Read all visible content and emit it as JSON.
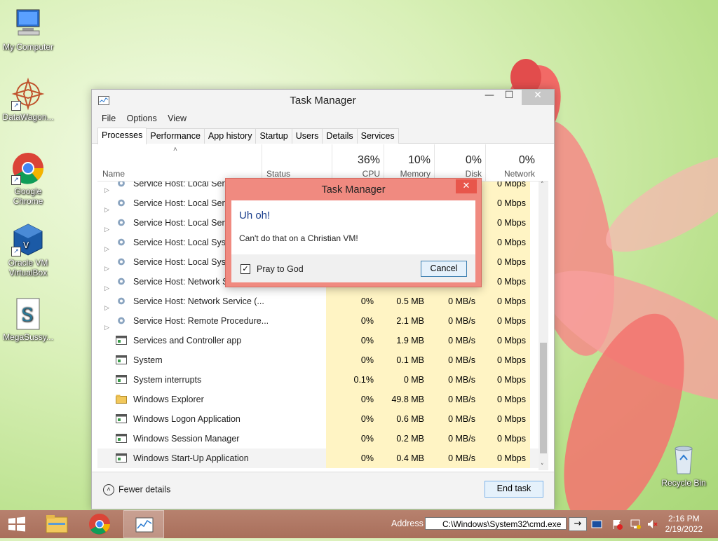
{
  "desktop": {
    "icons": [
      {
        "label": "My Computer"
      },
      {
        "label": "DataWagon..."
      },
      {
        "label": "Google Chrome"
      },
      {
        "label": "Oracle VM VirtualBox"
      },
      {
        "label": "MegaSussy..."
      },
      {
        "label": "Recycle Bin"
      }
    ]
  },
  "task_manager": {
    "title": "Task Manager",
    "menu": [
      "File",
      "Options",
      "View"
    ],
    "tabs": [
      "Processes",
      "Performance",
      "App history",
      "Startup",
      "Users",
      "Details",
      "Services"
    ],
    "active_tab": "Processes",
    "columns": {
      "name": "Name",
      "status": "Status",
      "cpu": {
        "pct": "36%",
        "label": "CPU"
      },
      "memory": {
        "pct": "10%",
        "label": "Memory"
      },
      "disk": {
        "pct": "0%",
        "label": "Disk"
      },
      "network": {
        "pct": "0%",
        "label": "Network"
      }
    },
    "rows": [
      {
        "name": "Service Host: Local Servic",
        "cpu": "",
        "memory": "",
        "disk": "",
        "network": "0 Mbps",
        "expandable": true,
        "icon": "gear-icon"
      },
      {
        "name": "Service Host: Local Servic",
        "cpu": "",
        "memory": "",
        "disk": "",
        "network": "0 Mbps",
        "expandable": true,
        "icon": "gear-icon"
      },
      {
        "name": "Service Host: Local Servic",
        "cpu": "",
        "memory": "",
        "disk": "",
        "network": "0 Mbps",
        "expandable": true,
        "icon": "gear-icon"
      },
      {
        "name": "Service Host: Local Syster",
        "cpu": "",
        "memory": "",
        "disk": "",
        "network": "0 Mbps",
        "expandable": true,
        "icon": "gear-icon"
      },
      {
        "name": "Service Host: Local Syster",
        "cpu": "",
        "memory": "",
        "disk": "",
        "network": "0 Mbps",
        "expandable": true,
        "icon": "gear-icon"
      },
      {
        "name": "Service Host: Network Se",
        "cpu": "",
        "memory": "",
        "disk": "",
        "network": "0 Mbps",
        "expandable": true,
        "icon": "gear-icon"
      },
      {
        "name": "Service Host: Network Service (...",
        "cpu": "0%",
        "memory": "0.5 MB",
        "disk": "0 MB/s",
        "network": "0 Mbps",
        "expandable": true,
        "icon": "gear-icon"
      },
      {
        "name": "Service Host: Remote Procedure...",
        "cpu": "0%",
        "memory": "2.1 MB",
        "disk": "0 MB/s",
        "network": "0 Mbps",
        "expandable": true,
        "icon": "gear-icon"
      },
      {
        "name": "Services and Controller app",
        "cpu": "0%",
        "memory": "1.9 MB",
        "disk": "0 MB/s",
        "network": "0 Mbps",
        "expandable": false,
        "icon": "app-window-icon"
      },
      {
        "name": "System",
        "cpu": "0%",
        "memory": "0.1 MB",
        "disk": "0 MB/s",
        "network": "0 Mbps",
        "expandable": false,
        "icon": "app-window-icon"
      },
      {
        "name": "System interrupts",
        "cpu": "0.1%",
        "memory": "0 MB",
        "disk": "0 MB/s",
        "network": "0 Mbps",
        "expandable": false,
        "icon": "app-window-icon"
      },
      {
        "name": "Windows Explorer",
        "cpu": "0%",
        "memory": "49.8 MB",
        "disk": "0 MB/s",
        "network": "0 Mbps",
        "expandable": false,
        "icon": "folder-icon"
      },
      {
        "name": "Windows Logon Application",
        "cpu": "0%",
        "memory": "0.6 MB",
        "disk": "0 MB/s",
        "network": "0 Mbps",
        "expandable": false,
        "icon": "app-window-icon"
      },
      {
        "name": "Windows Session Manager",
        "cpu": "0%",
        "memory": "0.2 MB",
        "disk": "0 MB/s",
        "network": "0 Mbps",
        "expandable": false,
        "icon": "app-window-icon"
      },
      {
        "name": "Windows Start-Up Application",
        "cpu": "0%",
        "memory": "0.4 MB",
        "disk": "0 MB/s",
        "network": "0 Mbps",
        "expandable": false,
        "icon": "app-window-icon"
      }
    ],
    "footer": {
      "fewer_details": "Fewer details",
      "end_task": "End task"
    }
  },
  "dialog": {
    "title": "Task Manager",
    "heading": "Uh oh!",
    "message": "Can't do that on a Christian VM!",
    "checkbox_label": "Pray to God",
    "checkbox_checked": true,
    "cancel": "Cancel"
  },
  "taskbar": {
    "address_label": "Address",
    "address_value": "C:\\Windows\\System32\\cmd.exe",
    "time": "2:16 PM",
    "date": "2/19/2022"
  },
  "colors": {
    "dialog_frame": "#f08a80",
    "taskbar": "#a96f5b",
    "heat_cell": "#fff4c4",
    "dialog_heading": "#1a3e8c"
  }
}
